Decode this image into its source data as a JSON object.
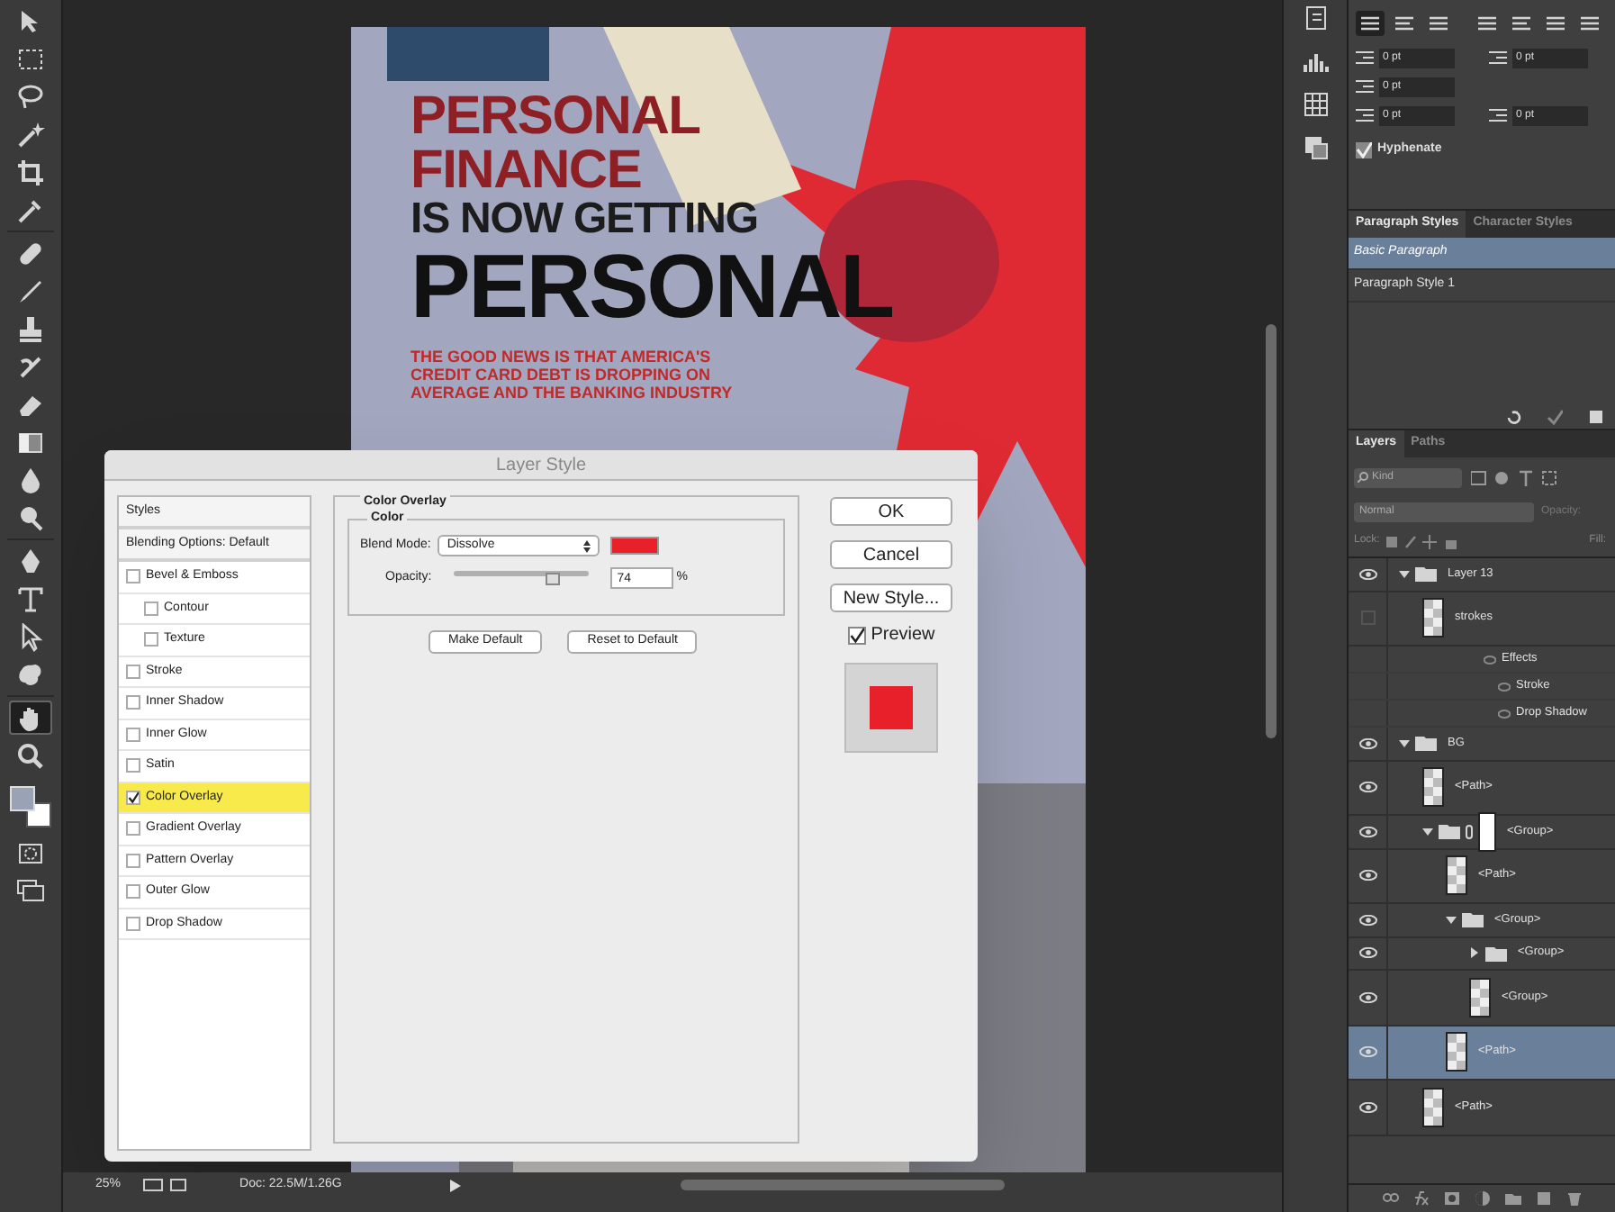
{
  "tools": [
    {
      "kind": "move",
      "selected": false
    },
    {
      "kind": "marquee",
      "selected": false
    },
    {
      "kind": "lasso",
      "selected": false
    },
    {
      "kind": "wand",
      "selected": false
    },
    {
      "kind": "crop",
      "selected": false
    },
    {
      "kind": "eyedropper",
      "selected": false
    },
    {
      "kind": "bandage",
      "selected": false
    },
    {
      "kind": "brush",
      "selected": false
    },
    {
      "kind": "stamp",
      "selected": false
    },
    {
      "kind": "history",
      "selected": false
    },
    {
      "kind": "eraser",
      "selected": false
    },
    {
      "kind": "gradient",
      "selected": false
    },
    {
      "kind": "drop",
      "selected": false
    },
    {
      "kind": "dodge",
      "selected": false
    },
    {
      "kind": "pen",
      "selected": false
    },
    {
      "kind": "type",
      "selected": false
    },
    {
      "kind": "arrow",
      "selected": false
    },
    {
      "kind": "shape",
      "selected": false
    },
    {
      "kind": "hand",
      "selected": true
    },
    {
      "kind": "zoom",
      "selected": false
    }
  ],
  "document": {
    "headline": [
      {
        "text": "PERSONAL",
        "kind": "accent"
      },
      {
        "text": "FINANCE",
        "kind": "accent"
      },
      {
        "text": "IS NOW GETTING",
        "kind": "plain"
      },
      {
        "text": "PERSONAL",
        "kind": "big"
      }
    ],
    "body": [
      "THE GOOD NEWS IS THAT AMERICA'S",
      "CREDIT CARD DEBT IS DROPPING ON",
      "AVERAGE AND THE BANKING INDUSTRY"
    ]
  },
  "status_bar": {
    "zoom": "25%",
    "doc": "Doc: 22.5M/1.26G"
  },
  "dialog": {
    "title": "Layer Style",
    "styles": [
      {
        "label": "Styles",
        "kind": "header"
      },
      {
        "label": "Blending Options: Default",
        "kind": "header"
      },
      {
        "label": "Bevel & Emboss",
        "kind": "check",
        "checked": false,
        "selected": false,
        "children": [
          {
            "label": "Contour",
            "kind": "check",
            "checked": false,
            "selected": false
          },
          {
            "label": "Texture",
            "kind": "check",
            "checked": false,
            "selected": false
          }
        ]
      },
      {
        "label": "Stroke",
        "kind": "check",
        "checked": false,
        "selected": false
      },
      {
        "label": "Inner Shadow",
        "kind": "check",
        "checked": false,
        "selected": false
      },
      {
        "label": "Inner Glow",
        "kind": "check",
        "checked": false,
        "selected": false
      },
      {
        "label": "Satin",
        "kind": "check",
        "checked": false,
        "selected": false
      },
      {
        "label": "Color Overlay",
        "kind": "check",
        "checked": true,
        "selected": true
      },
      {
        "label": "Gradient Overlay",
        "kind": "check",
        "checked": false,
        "selected": false
      },
      {
        "label": "Pattern Overlay",
        "kind": "check",
        "checked": false,
        "selected": false
      },
      {
        "label": "Outer Glow",
        "kind": "check",
        "checked": false,
        "selected": false
      },
      {
        "label": "Drop Shadow",
        "kind": "check",
        "checked": false,
        "selected": false
      }
    ],
    "section": "Color Overlay",
    "group": "Color",
    "blend_mode": {
      "label": "Blend Mode:",
      "value": "Dissolve",
      "color": "#e8202a"
    },
    "opacity": {
      "label": "Opacity:",
      "level": 0.74,
      "value": "74",
      "unit": "%"
    },
    "buttons": [
      "Make Default",
      "Reset to Default"
    ],
    "side_buttons": [
      {
        "label": "OK"
      },
      {
        "label": "Cancel"
      },
      {
        "label": "New Style..."
      }
    ],
    "preview": {
      "label": "Preview",
      "checked": true
    }
  },
  "paragraph": {
    "align": [
      {
        "selected": true
      },
      {
        "selected": false
      },
      {
        "selected": false
      },
      {
        "selected": false
      },
      {
        "selected": false
      },
      {
        "selected": false
      },
      {
        "selected": false
      }
    ],
    "fields": [
      "0 pt",
      "0 pt",
      "0 pt",
      "0 pt",
      "0 pt"
    ],
    "hyphenate": {
      "label": "Hyphenate",
      "checked": true
    }
  },
  "style_panel": {
    "tabs": [
      {
        "label": "Paragraph Styles",
        "selected": true
      },
      {
        "label": "Character Styles",
        "selected": false
      }
    ],
    "items": [
      {
        "label": "Basic Paragraph",
        "selected": true
      },
      {
        "label": "Paragraph Style 1",
        "selected": false
      }
    ]
  },
  "layers_panel": {
    "tabs": [
      {
        "label": "Layers",
        "selected": true
      },
      {
        "label": "Paths",
        "selected": false
      }
    ],
    "filter": "Kind",
    "blend": "Normal",
    "opacity_label": "Opacity:",
    "lock_label": "Lock:",
    "fill_label": "Fill:",
    "layers": [
      {
        "name": "Layer 13",
        "kind": "folder",
        "visible": true,
        "expanded": true,
        "selected": false,
        "children": [
          {
            "name": "strokes",
            "kind": "layer",
            "visible": false,
            "selected": false,
            "effects": {
              "label": "Effects",
              "items": [
                "Stroke",
                "Drop Shadow"
              ]
            }
          }
        ]
      },
      {
        "name": "BG",
        "kind": "folder",
        "visible": true,
        "expanded": true,
        "selected": false,
        "children": [
          {
            "name": "<Path>",
            "kind": "layer",
            "visible": true,
            "selected": false
          },
          {
            "name": "<Group>",
            "kind": "folder",
            "visible": true,
            "expanded": true,
            "selected": false,
            "mask": true,
            "children": [
              {
                "name": "<Path>",
                "kind": "layer",
                "visible": true,
                "selected": false
              },
              {
                "name": "<Group>",
                "kind": "folder",
                "visible": true,
                "expanded": true,
                "selected": false,
                "children": [
                  {
                    "name": "<Group>",
                    "kind": "folder",
                    "visible": true,
                    "expanded": false,
                    "selected": false
                  },
                  {
                    "name": "<Group>",
                    "kind": "layer",
                    "visible": true,
                    "selected": false
                  }
                ]
              },
              {
                "name": "<Path>",
                "kind": "layer",
                "visible": true,
                "selected": true
              }
            ]
          },
          {
            "name": "<Path>",
            "kind": "layer",
            "visible": true,
            "selected": false
          }
        ]
      }
    ]
  }
}
